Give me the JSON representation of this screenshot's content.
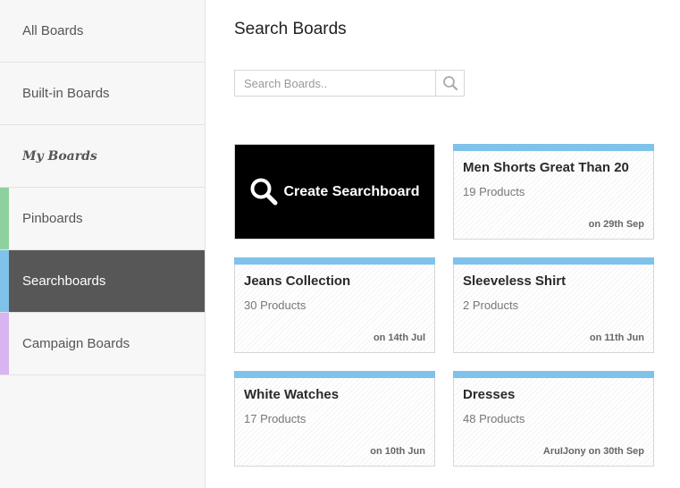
{
  "sidebar": {
    "items": [
      {
        "label": "All Boards"
      },
      {
        "label": "Built-in Boards"
      },
      {
        "label": "My Boards"
      },
      {
        "label": "Pinboards",
        "stripe": "#8fd19e"
      },
      {
        "label": "Searchboards",
        "stripe": "#7fc2ea"
      },
      {
        "label": "Campaign Boards",
        "stripe": "#d8b4f0"
      }
    ]
  },
  "main": {
    "title": "Search Boards",
    "search": {
      "placeholder": "Search Boards.."
    },
    "create_label": "Create Searchboard",
    "boards": [
      {
        "name": "Men Shorts Great Than 20",
        "count": "19 Products",
        "date": "on 29th Sep"
      },
      {
        "name": "Jeans Collection",
        "count": "30 Products",
        "date": "on 14th Jul"
      },
      {
        "name": "Sleeveless Shirt",
        "count": "2 Products",
        "date": "on 11th Jun"
      },
      {
        "name": "White Watches",
        "count": "17 Products",
        "date": "on 10th Jun"
      },
      {
        "name": "Dresses",
        "count": "48 Products",
        "date": "AruIJony on 30th Sep"
      }
    ]
  },
  "colors": {
    "accent": "#7fc2ea",
    "active_bg": "#575757"
  }
}
